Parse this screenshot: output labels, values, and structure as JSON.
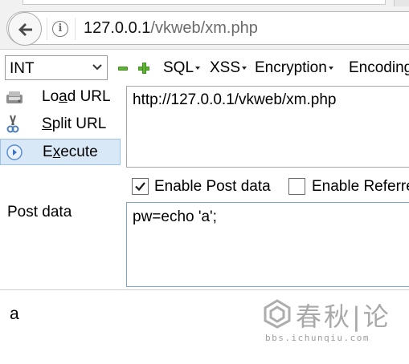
{
  "browser": {
    "url_host": "127.0.0.1",
    "url_path": "/vkweb/xm.php",
    "back_icon": "arrow-left-icon",
    "info_icon": "info-icon"
  },
  "hackbar": {
    "type_select": "INT",
    "menus": [
      "SQL",
      "XSS",
      "Encryption",
      "Encoding"
    ],
    "actions": {
      "load_pre": "Lo",
      "load_mid": "a",
      "load_post": "d URL",
      "split_pre": "",
      "split_mid": "S",
      "split_post": "plit URL",
      "exec_pre": "E",
      "exec_mid": "x",
      "exec_post": "ecute"
    },
    "url_field": "http://127.0.0.1/vkweb/xm.php",
    "enable_post_label": "Enable Post data",
    "enable_post_checked": true,
    "enable_referrer_label": "Enable Referrer",
    "enable_referrer_checked": false,
    "post_label": "Post data",
    "post_field": "pw=echo 'a';"
  },
  "output": {
    "text": "a"
  },
  "watermark": {
    "chinese": "春秋|论",
    "url": "bbs.ichunqiu.com"
  },
  "colors": {
    "accent_green": "#5fb336",
    "selected_row": "#d9e8f7"
  }
}
